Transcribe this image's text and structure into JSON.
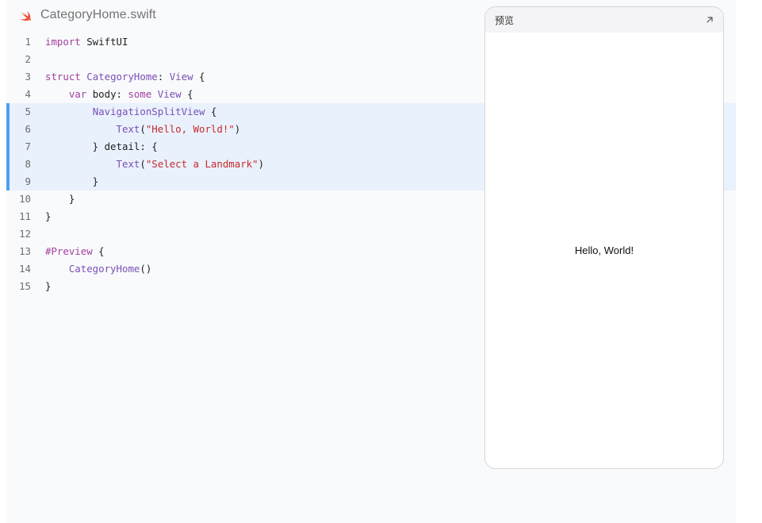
{
  "file": {
    "name": "CategoryHome.swift",
    "icon": "swift-logo-icon"
  },
  "code": {
    "lines": [
      {
        "n": "1",
        "hl": false,
        "tokens": [
          {
            "t": "import",
            "c": "kw"
          },
          {
            "t": " SwiftUI",
            "c": ""
          }
        ]
      },
      {
        "n": "2",
        "hl": false,
        "tokens": []
      },
      {
        "n": "3",
        "hl": false,
        "tokens": [
          {
            "t": "struct",
            "c": "kw"
          },
          {
            "t": " ",
            "c": ""
          },
          {
            "t": "CategoryHome",
            "c": "ty"
          },
          {
            "t": ": ",
            "c": ""
          },
          {
            "t": "View",
            "c": "ty"
          },
          {
            "t": " {",
            "c": ""
          }
        ]
      },
      {
        "n": "4",
        "hl": false,
        "tokens": [
          {
            "t": "    ",
            "c": ""
          },
          {
            "t": "var",
            "c": "kw"
          },
          {
            "t": " body: ",
            "c": ""
          },
          {
            "t": "some",
            "c": "kw"
          },
          {
            "t": " ",
            "c": ""
          },
          {
            "t": "View",
            "c": "ty"
          },
          {
            "t": " {",
            "c": ""
          }
        ]
      },
      {
        "n": "5",
        "hl": true,
        "tokens": [
          {
            "t": "        ",
            "c": ""
          },
          {
            "t": "NavigationSplitView",
            "c": "ty"
          },
          {
            "t": " {",
            "c": ""
          }
        ]
      },
      {
        "n": "6",
        "hl": true,
        "tokens": [
          {
            "t": "            ",
            "c": ""
          },
          {
            "t": "Text",
            "c": "ty"
          },
          {
            "t": "(",
            "c": ""
          },
          {
            "t": "\"Hello, World!\"",
            "c": "str"
          },
          {
            "t": ")",
            "c": ""
          }
        ]
      },
      {
        "n": "7",
        "hl": true,
        "tokens": [
          {
            "t": "        } detail: {",
            "c": ""
          }
        ]
      },
      {
        "n": "8",
        "hl": true,
        "tokens": [
          {
            "t": "            ",
            "c": ""
          },
          {
            "t": "Text",
            "c": "ty"
          },
          {
            "t": "(",
            "c": ""
          },
          {
            "t": "\"Select a Landmark\"",
            "c": "str"
          },
          {
            "t": ")",
            "c": ""
          }
        ]
      },
      {
        "n": "9",
        "hl": true,
        "tokens": [
          {
            "t": "        }",
            "c": ""
          }
        ]
      },
      {
        "n": "10",
        "hl": false,
        "tokens": [
          {
            "t": "    }",
            "c": ""
          }
        ]
      },
      {
        "n": "11",
        "hl": false,
        "tokens": [
          {
            "t": "}",
            "c": ""
          }
        ]
      },
      {
        "n": "12",
        "hl": false,
        "tokens": []
      },
      {
        "n": "13",
        "hl": false,
        "tokens": [
          {
            "t": "#Preview",
            "c": "kw"
          },
          {
            "t": " {",
            "c": ""
          }
        ]
      },
      {
        "n": "14",
        "hl": false,
        "tokens": [
          {
            "t": "    ",
            "c": ""
          },
          {
            "t": "CategoryHome",
            "c": "ty"
          },
          {
            "t": "()",
            "c": ""
          }
        ]
      },
      {
        "n": "15",
        "hl": false,
        "tokens": [
          {
            "t": "}",
            "c": ""
          }
        ]
      }
    ]
  },
  "preview": {
    "title": "预览",
    "expand_icon": "expand-arrow-icon",
    "content_text": "Hello, World!"
  },
  "colors": {
    "keyword": "#a2409d",
    "type": "#7950b5",
    "string": "#c72a2a",
    "highlight_bg": "#e9f1fd",
    "highlight_bar": "#4e9ff0",
    "swift_orange": "#f05138"
  }
}
